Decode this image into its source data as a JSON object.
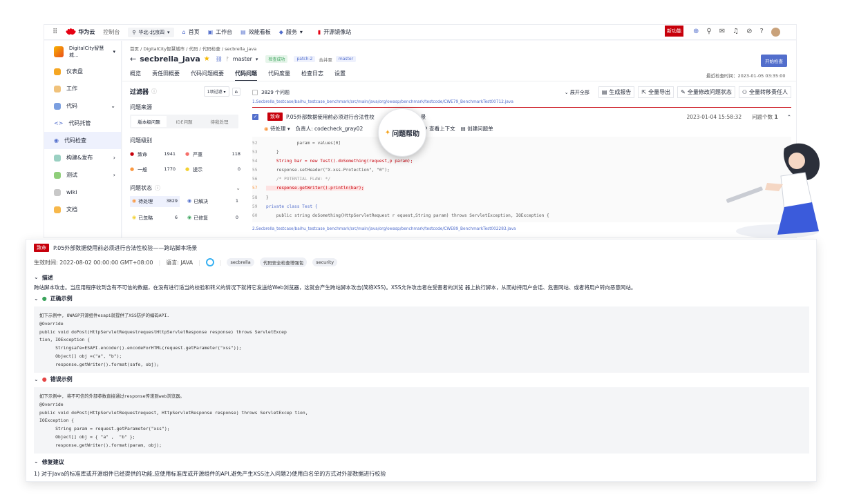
{
  "topbar": {
    "brand": "华为云",
    "console": "控制台",
    "region": "华北-北京四",
    "nav": [
      "首页",
      "工作台",
      "效能看板",
      "服务",
      "开源镜像站"
    ],
    "new_badge": "新功能"
  },
  "sidebar": {
    "project": "DigitalCity智慧城...",
    "items": [
      {
        "label": "仪表盘"
      },
      {
        "label": "工作"
      },
      {
        "label": "代码"
      },
      {
        "label": "代码托管"
      },
      {
        "label": "代码检查"
      },
      {
        "label": "构建&发布"
      },
      {
        "label": "测试"
      },
      {
        "label": "wiki"
      },
      {
        "label": "文档"
      }
    ]
  },
  "header": {
    "breadcrumb": "首页 / DigitalCity智慧城市 / 代码 / 代码检查 / secbrella_java",
    "repo": "secbrella_java",
    "branch": "master",
    "status": "检查成功",
    "patch": "patch-2",
    "merge_to": "合并至",
    "target_branch": "master",
    "start_button": "开始检查",
    "tabs": [
      "概览",
      "责任田概要",
      "代码问题概要",
      "代码问题",
      "代码度量",
      "检查日志",
      "设置"
    ],
    "last_check": "最近检查时间：2023-01-05 03:35:00"
  },
  "filter": {
    "title": "过滤器",
    "filter_select": "1项过滤",
    "source_title": "问题来源",
    "source_tabs": [
      "版本级问题",
      "IDE问题",
      "待我处理"
    ],
    "level_title": "问题级别",
    "levels": [
      {
        "label": "致命",
        "count": "1941",
        "color": "#c7000b"
      },
      {
        "label": "严重",
        "count": "118",
        "color": "#f66f6a"
      },
      {
        "label": "一般",
        "count": "1770",
        "color": "#fa9841"
      },
      {
        "label": "提示",
        "count": "0",
        "color": "#f3d131"
      }
    ],
    "status_title": "问题状态",
    "statuses": [
      {
        "label": "待处理",
        "count": "3829"
      },
      {
        "label": "已解决",
        "count": "1"
      },
      {
        "label": "已忽略",
        "count": "6"
      },
      {
        "label": "已修复",
        "count": "0"
      }
    ]
  },
  "issues": {
    "count_label": "3829 个问题",
    "expand_all": "展开全部",
    "actions": [
      "生成报告",
      "全量导出",
      "全量修改问题状态",
      "全量转移责任人"
    ],
    "path1": "1.Secbrella_testcase/baihu_testcase_benchmark/src/main/java/org/owasp/benchmark/testcode/CWE79_BenchmarkTest00712.java",
    "severity": "致命",
    "title_short": "P.05外部数据使用前必须进行合法性校",
    "title_tail": "景",
    "date": "2023-01-04 15:58:32",
    "count_text": "问题个数",
    "count_value": "1",
    "status": "待处理",
    "owner": "负责人: codecheck_gray02",
    "help": "问题帮助",
    "context": "查看上下文",
    "create": "创建问题单",
    "code_lines": [
      {
        "n": "52",
        "t": "            param = values[0]"
      },
      {
        "n": "53",
        "t": "    }"
      },
      {
        "n": "54",
        "t": "    String bar = new Test().doSomething(request,p param);"
      },
      {
        "n": "55",
        "t": "    response.setHeader(\"X-xss-Protection\", \"0\");"
      },
      {
        "n": "56",
        "t": "    /* POTENTIAL FLAW: */"
      },
      {
        "n": "57",
        "t": "    response.getWriter().println(bar);"
      },
      {
        "n": "58",
        "t": "}"
      },
      {
        "n": "59",
        "t": "private class Test {"
      },
      {
        "n": "60",
        "t": "    public string doSomething(HttpServletRequest r equest,String param) throws ServletException, IOException {"
      }
    ],
    "path2": "2.Secbrella_testcase/baihu_testcase_benchmark/src/main/java/org/owasp/benchmark/testcode/CWE89_BenchmarkTest002283.java"
  },
  "detail": {
    "severity": "致命",
    "title": "P.05外部数据使用前必须进行合法性校验——跨站脚本场景",
    "effective": "生效时间: 2022-08-02 00:00:00 GMT+08:00",
    "language": "语言: JAVA",
    "tags": [
      "secbrella",
      "代码安全检查增强包",
      "security"
    ],
    "desc_title": "描述",
    "desc": "跨站脚本攻击。当应用程序收到含有不可信的数据，在没有进行适当的校验和转义的情况下就将它发送给Web浏览器，这就会产生跨站脚本攻击(简称XSS)。XSS允许攻击者在受害者的浏览 器上执行脚本，从而劫持用户会话、危害网站、或者将用户转向恶意网站。",
    "correct_title": "正确示例",
    "correct_code": "如下示例中, OWASP开源组件esapi就提供了XSS防护的编码API.\n@Override\npublic void doPost(HttpServletRequestrequestHttpServletResponse response) throws ServletExcep\ntion, IOException {\n      Stringsafe=ESAPI.encoder().encodeForHTML(request.getParameter(\"xss\"));\n      Object[] obj =(\"a\", \"b\");\n      response.getWriter().format(safe, obj);",
    "wrong_title": "错误示例",
    "wrong_code": "如下示例中, 将不可信的外部参数直接通过response传递到web浏览器。\n@Override\npublic void doPost(HttpServletRequestrequest, HttpServletResponse response) throws ServletExcep tion,\nIOException {\n      String param = request.getParameter(\"xss\");\n      Object[] obj = { \"a\" ,  \"b\" };\n      response.getWriter().format(param, obj);",
    "fix_title": "修复建议",
    "fix": "1) 对于Java的标准库或开源组件已经提供的功能,应使用标准库或开源组件的API,避免产生XSS注入问题2)使用白名单的方式对外部数据进行校验"
  }
}
